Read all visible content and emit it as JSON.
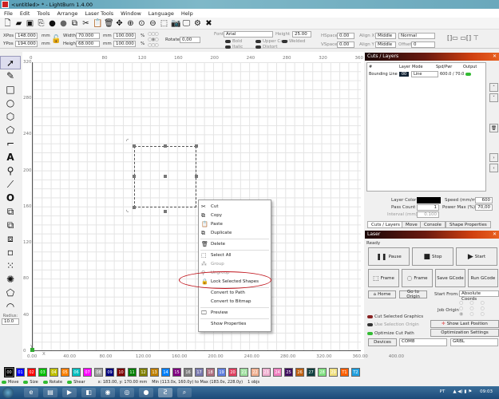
{
  "window": {
    "title": "<untitled> * - LightBurn 1.4.00"
  },
  "menu": [
    "File",
    "Edit",
    "Tools",
    "Arrange",
    "Laser Tools",
    "Window",
    "Language",
    "Help"
  ],
  "toolbar_icons": [
    "new-file",
    "open-folder",
    "save",
    "import",
    "circle-dark",
    "circle-grey",
    "copy",
    "cut",
    "paste",
    "delete",
    "move",
    "zoom-in",
    "zoom-fit",
    "zoom-out",
    "select-frame",
    "camera",
    "monitor",
    "settings",
    "tools"
  ],
  "props": {
    "xpos_label": "XPos",
    "xpos": "148.000",
    "ypos_label": "YPos",
    "ypos": "194.000",
    "unit": "mm",
    "width_label": "Width",
    "width": "70.000",
    "height_label": "Height",
    "height": "68.000",
    "wpct": "100.000",
    "hpct": "100.000",
    "pct": "%",
    "rotate_label": "Rotate",
    "rotate": "0,00",
    "font_label": "Font",
    "font": "Arial",
    "fheight_label": "Height",
    "fheight": "25.00",
    "hspace_label": "HSpace",
    "hspace": "0.00",
    "vspace_label": "VSpace",
    "vspace": "0.00",
    "alignx_label": "Align X",
    "alignx": "Middle",
    "aligny_label": "Align Y",
    "aligny": "Middle",
    "style": "Normal",
    "offset_label": "Offset",
    "offset": "0",
    "bold": "Bold",
    "italic": "Italic",
    "upper": "Upper Case",
    "welded": "Welded",
    "distort": "Distort"
  },
  "left_tools": [
    "select",
    "pen",
    "rectangle",
    "ellipse",
    "polygon",
    "pentagon",
    "frame",
    "text",
    "position",
    "measure",
    "offset",
    "boolean-union",
    "boolean-subtract",
    "boolean-intersect",
    "weld",
    "array",
    "circular-array",
    "corner",
    "rounded-corner"
  ],
  "radius": {
    "label": "Radius:",
    "value": "10.0"
  },
  "rulers": {
    "top": [
      "0",
      "80",
      "120",
      "160",
      "200",
      "240",
      "280",
      "320",
      "360"
    ],
    "left": [
      "320",
      "280",
      "240",
      "200",
      "160",
      "120",
      "80",
      "40",
      "0"
    ],
    "bottom": [
      "0.00",
      "40.00",
      "80.00",
      "120.00",
      "160.00",
      "200.00",
      "240.00",
      "280.00",
      "320.00",
      "360.00",
      "400.00"
    ],
    "y_axis": "Y",
    "x_axis": "X"
  },
  "context_menu": [
    {
      "label": "Cut",
      "icon": "scissors",
      "enabled": true
    },
    {
      "label": "Copy",
      "icon": "copy",
      "enabled": true
    },
    {
      "label": "Paste",
      "icon": "paste",
      "enabled": true
    },
    {
      "label": "Duplicate",
      "icon": "duplicate",
      "enabled": true
    },
    {
      "label": "Delete",
      "icon": "trash",
      "enabled": true
    },
    {
      "label": "Select All",
      "icon": "select-all",
      "enabled": true
    },
    {
      "label": "Group",
      "icon": "group",
      "enabled": false
    },
    {
      "label": "Ungroup",
      "icon": "ungroup",
      "enabled": false
    },
    {
      "label": "Lock Selected Shapes",
      "icon": "lock",
      "enabled": true,
      "highlighted": true
    },
    {
      "label": "Convert to Path",
      "enabled": true
    },
    {
      "label": "Convert to Bitmap",
      "enabled": true
    },
    {
      "label": "Preview",
      "icon": "monitor",
      "enabled": true
    },
    {
      "label": "Show Properties",
      "enabled": true
    }
  ],
  "cuts": {
    "title": "Cuts / Layers",
    "headers": [
      "#",
      "Layer",
      "Mode",
      "Spd/Pwr",
      "Output"
    ],
    "rows": [
      {
        "name": "Bounding Line",
        "layer": "00",
        "mode": "Line",
        "spdpwr": "600.0 / 70.0",
        "output": true
      }
    ],
    "layer_color_label": "Layer Color",
    "speed_label": "Speed (mm/m)",
    "speed": "600",
    "pass_label": "Pass Count",
    "pass": "1",
    "power_label": "Power Max (%)",
    "power": "70,00",
    "interval_label": "Interval (mm)",
    "interval": "0.100"
  },
  "tabs": [
    "Cuts / Layers",
    "Move",
    "Console",
    "Shape Properties"
  ],
  "laser": {
    "title": "Laser",
    "status": "Ready",
    "pause": "Pause",
    "stop": "Stop",
    "start": "Start",
    "frame1": "Frame",
    "frame2": "Frame",
    "save_gcode": "Save GCode",
    "run_gcode": "Run GCode",
    "home": "Home",
    "go_origin": "Go to Origin",
    "start_from_label": "Start From:",
    "start_from": "Absolute Coords",
    "job_origin": "Job Origin",
    "cut_selected": "Cut Selected Graphics",
    "use_selection": "Use Selection Origin",
    "optimize": "Optimize Cut Path",
    "show_last": "Show Last Position",
    "opt_settings": "Optimization Settings",
    "devices": "Devices",
    "port": "COM8",
    "controller": "GRBL"
  },
  "palette": [
    {
      "l": "00",
      "c": "#000000"
    },
    {
      "l": "01",
      "c": "#0000ff"
    },
    {
      "l": "02",
      "c": "#ff0000"
    },
    {
      "l": "03",
      "c": "#00c000"
    },
    {
      "l": "04",
      "c": "#c0c000"
    },
    {
      "l": "05",
      "c": "#ff8000"
    },
    {
      "l": "06",
      "c": "#00c0c0"
    },
    {
      "l": "07",
      "c": "#ff00ff"
    },
    {
      "l": "08",
      "c": "#a0a0a0"
    },
    {
      "l": "09",
      "c": "#000080"
    },
    {
      "l": "10",
      "c": "#800000"
    },
    {
      "l": "11",
      "c": "#008000"
    },
    {
      "l": "12",
      "c": "#808000"
    },
    {
      "l": "13",
      "c": "#c08000"
    },
    {
      "l": "14",
      "c": "#0080ff"
    },
    {
      "l": "15",
      "c": "#800080"
    },
    {
      "l": "16",
      "c": "#808080"
    },
    {
      "l": "17",
      "c": "#7a7ab0"
    },
    {
      "l": "18",
      "c": "#b07080"
    },
    {
      "l": "19",
      "c": "#6080e0"
    },
    {
      "l": "20",
      "c": "#e04060"
    },
    {
      "l": "21",
      "c": "#a0e0a0"
    },
    {
      "l": "22",
      "c": "#f0b090"
    },
    {
      "l": "23",
      "c": "#f0b0d0"
    },
    {
      "l": "24",
      "c": "#f080c0"
    },
    {
      "l": "25",
      "c": "#401060"
    },
    {
      "l": "26",
      "c": "#c06010"
    },
    {
      "l": "27",
      "c": "#104040"
    },
    {
      "l": "28",
      "c": "#80e080"
    },
    {
      "l": "29",
      "c": "#f0e080"
    },
    {
      "l": "T1",
      "c": "#ff6000"
    },
    {
      "l": "T2",
      "c": "#20a0e0"
    }
  ],
  "status": {
    "move": "Move",
    "size": "Size",
    "rotate": "Rotate",
    "shear": "Shear",
    "coords": "x: 183.00, y: 170.00 mm",
    "bounds": "Min (113.0x, 160.0y) to Max (183.0x, 228.0y)",
    "count": "1 objs"
  },
  "taskbar": {
    "lang": "PT",
    "time": "09:03"
  }
}
